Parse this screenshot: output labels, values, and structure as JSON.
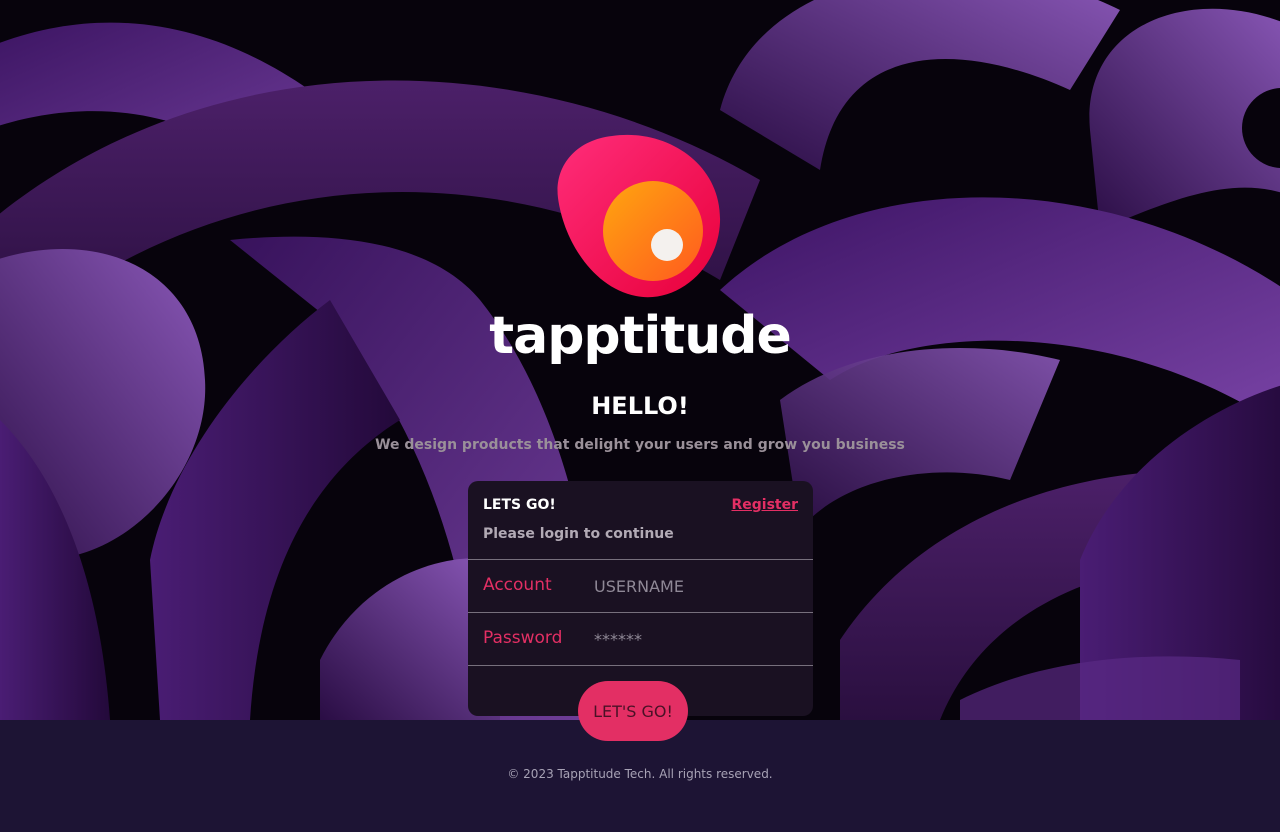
{
  "brand": {
    "name": "tapptitude"
  },
  "hero": {
    "greeting": "HELLO!",
    "tagline": "We design products that delight your users and grow you business"
  },
  "login_card": {
    "title": "LETS GO!",
    "register_link": "Register",
    "subtitle": "Please login to continue",
    "account_label": "Account",
    "account_placeholder": "USERNAME",
    "password_label": "Password",
    "password_placeholder": "******",
    "submit_label": "LET'S GO!"
  },
  "footer": {
    "copyright": "© 2023 Tapptitude Tech. All rights reserved."
  },
  "colors": {
    "accent": "#e32f64",
    "card_bg": "#1a1122",
    "footer_bg": "#1d1434",
    "background_purple": "#5a2a85"
  }
}
